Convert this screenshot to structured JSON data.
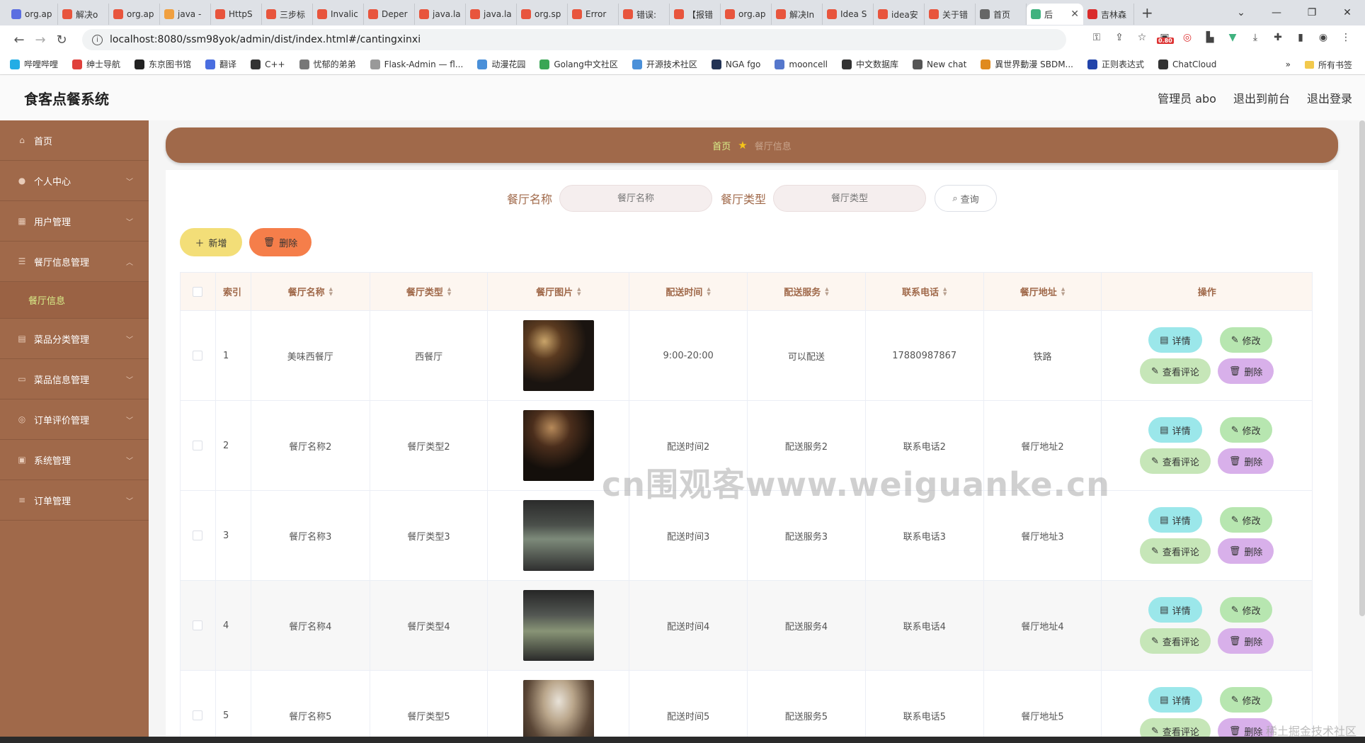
{
  "browser": {
    "tabs": [
      {
        "label": "org.ap",
        "color": "#5b6ee1",
        "icon": "app-icon"
      },
      {
        "label": "解决o",
        "color": "#e8553d",
        "icon": "csdn-icon"
      },
      {
        "label": "org.ap",
        "color": "#e8553d",
        "icon": "csdn-icon"
      },
      {
        "label": "java -",
        "color": "#f0a040",
        "icon": "java-icon"
      },
      {
        "label": "HttpS",
        "color": "#e8553d",
        "icon": "csdn-icon"
      },
      {
        "label": "三步标",
        "color": "#e8553d",
        "icon": "csdn-icon"
      },
      {
        "label": "Invalic",
        "color": "#e8553d",
        "icon": "csdn-icon"
      },
      {
        "label": "Deper",
        "color": "#e8553d",
        "icon": "csdn-icon"
      },
      {
        "label": "java.la",
        "color": "#e8553d",
        "icon": "csdn-icon"
      },
      {
        "label": "java.la",
        "color": "#e8553d",
        "icon": "csdn-icon"
      },
      {
        "label": "org.sp",
        "color": "#e8553d",
        "icon": "csdn-icon"
      },
      {
        "label": "Error",
        "color": "#e8553d",
        "icon": "csdn-icon"
      },
      {
        "label": "错误:",
        "color": "#e8553d",
        "icon": "csdn-icon"
      },
      {
        "label": "【报错",
        "color": "#e8553d",
        "icon": "csdn-icon"
      },
      {
        "label": "org.ap",
        "color": "#e8553d",
        "icon": "csdn-icon"
      },
      {
        "label": "解决In",
        "color": "#e8553d",
        "icon": "csdn-icon"
      },
      {
        "label": "Idea S",
        "color": "#e8553d",
        "icon": "csdn-icon"
      },
      {
        "label": "idea安",
        "color": "#e8553d",
        "icon": "csdn-icon"
      },
      {
        "label": "关于错",
        "color": "#e8553d",
        "icon": "csdn-icon"
      },
      {
        "label": "首页",
        "color": "#666666",
        "icon": "globe-icon"
      },
      {
        "label": "后",
        "color": "#3fb27f",
        "icon": "vue-icon",
        "active": true
      },
      {
        "label": "吉林森",
        "color": "#d92b2b",
        "icon": "v-icon"
      }
    ],
    "url": "localhost:8080/ssm98yok/admin/dist/index.html#/cantingxinxi",
    "bookmarks": [
      {
        "label": "哔哩哔哩",
        "color": "#23ade5"
      },
      {
        "label": "绅士导航",
        "color": "#e0413c"
      },
      {
        "label": "东京图书馆",
        "color": "#222222"
      },
      {
        "label": "翻译",
        "color": "#4a6ee0"
      },
      {
        "label": "C++",
        "color": "#333333"
      },
      {
        "label": "忧郁的弟弟",
        "color": "#777777"
      },
      {
        "label": "Flask-Admin — fl...",
        "color": "#999999"
      },
      {
        "label": "动漫花园",
        "color": "#4a90d9"
      },
      {
        "label": "Golang中文社区",
        "color": "#3aa655"
      },
      {
        "label": "开源技术社区",
        "color": "#4a90d9"
      },
      {
        "label": "NGA fgo",
        "color": "#223355"
      },
      {
        "label": "mooncell",
        "color": "#5577cc"
      },
      {
        "label": "中文数据库",
        "color": "#333333"
      },
      {
        "label": "New chat",
        "color": "#555555"
      },
      {
        "label": "異世界動漫 SBDM...",
        "color": "#e08a1e"
      },
      {
        "label": "正则表达式",
        "color": "#2244aa"
      },
      {
        "label": "ChatCloud",
        "color": "#333333"
      }
    ],
    "bookmarks_more": "»",
    "all_bookmarks": "所有书签",
    "badge": "0.80"
  },
  "header": {
    "title": "食客点餐系统",
    "user": "管理员 abo",
    "to_front": "退出到前台",
    "logout": "退出登录"
  },
  "sidebar": {
    "items": [
      {
        "label": "首页",
        "icon": "home-icon"
      },
      {
        "label": "个人中心",
        "icon": "user-icon",
        "chevron": true
      },
      {
        "label": "用户管理",
        "icon": "users-icon",
        "chevron": true
      },
      {
        "label": "餐厅信息管理",
        "icon": "list-icon",
        "chevron": true,
        "open": true
      },
      {
        "label": "菜品分类管理",
        "icon": "category-icon",
        "chevron": true
      },
      {
        "label": "菜品信息管理",
        "icon": "message-icon",
        "chevron": true
      },
      {
        "label": "订单评价管理",
        "icon": "review-icon",
        "chevron": true
      },
      {
        "label": "系统管理",
        "icon": "system-icon",
        "chevron": true
      },
      {
        "label": "订单管理",
        "icon": "order-icon",
        "chevron": true
      }
    ],
    "sub_item": "餐厅信息"
  },
  "breadcrumb": {
    "home": "首页",
    "current": "餐厅信息"
  },
  "search": {
    "name_label": "餐厅名称",
    "name_placeholder": "餐厅名称",
    "type_label": "餐厅类型",
    "type_placeholder": "餐厅类型",
    "query_button": "查询"
  },
  "actions": {
    "add": "新增",
    "delete": "删除"
  },
  "table": {
    "columns": [
      "索引",
      "餐厅名称",
      "餐厅类型",
      "餐厅图片",
      "配送时间",
      "配送服务",
      "联系电话",
      "餐厅地址",
      "操作"
    ],
    "rows": [
      {
        "index": "1",
        "name": "美味西餐厅",
        "type": "西餐厅",
        "time": "9:00-20:00",
        "service": "可以配送",
        "phone": "17880987867",
        "address": "铁路"
      },
      {
        "index": "2",
        "name": "餐厅名称2",
        "type": "餐厅类型2",
        "time": "配送时间2",
        "service": "配送服务2",
        "phone": "联系电话2",
        "address": "餐厅地址2"
      },
      {
        "index": "3",
        "name": "餐厅名称3",
        "type": "餐厅类型3",
        "time": "配送时间3",
        "service": "配送服务3",
        "phone": "联系电话3",
        "address": "餐厅地址3"
      },
      {
        "index": "4",
        "name": "餐厅名称4",
        "type": "餐厅类型4",
        "time": "配送时间4",
        "service": "配送服务4",
        "phone": "联系电话4",
        "address": "餐厅地址4"
      },
      {
        "index": "5",
        "name": "餐厅名称5",
        "type": "餐厅类型5",
        "time": "配送时间5",
        "service": "配送服务5",
        "phone": "联系电话5",
        "address": "餐厅地址5"
      }
    ],
    "op_detail": "详情",
    "op_edit": "修改",
    "op_review": "查看评论",
    "op_delete": "删除"
  },
  "watermark": "cn围观客www.weiguanke.cn",
  "corner_mark": "稀土掘金技术社区",
  "colors": {
    "brand": "#a0694a",
    "breadcrumb_home": "#d9f08a"
  }
}
